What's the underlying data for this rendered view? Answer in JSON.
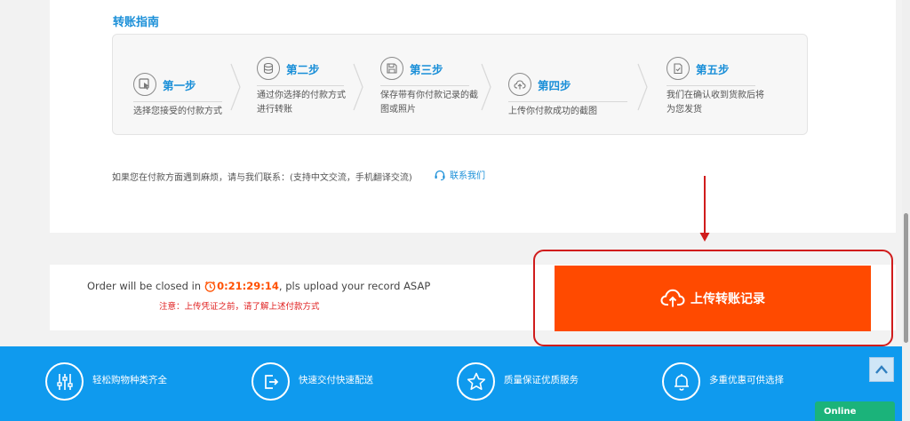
{
  "guide": {
    "title": "转账指南",
    "steps": [
      {
        "name": "第一步",
        "desc": [
          "选择您接受的付款方式"
        ],
        "icon": "cursor-icon"
      },
      {
        "name": "第二步",
        "desc": [
          "通过你选择的付款方式",
          "进行转账"
        ],
        "icon": "coins-icon"
      },
      {
        "name": "第三步",
        "desc": [
          "保存带有你付款记录的截",
          "图或照片"
        ],
        "icon": "save-icon"
      },
      {
        "name": "第四步",
        "desc": [
          "上传你付款成功的截图"
        ],
        "icon": "cloud-upload-icon"
      },
      {
        "name": "第五步",
        "desc": [
          "我们在确认收到货款后将",
          "为您发货"
        ],
        "icon": "clipboard-check-icon"
      }
    ],
    "contact_text": "如果您在付款方面遇到麻烦，请与我们联系：(支持中文交流，手机翻译交流)",
    "contact_link": "联系我们"
  },
  "order": {
    "prefix": "Order will be closed in",
    "countdown": "0:21:29:14",
    "suffix": ", pls upload your record ASAP",
    "note": "注意：上传凭证之前，请了解上述付款方式"
  },
  "upload_button": "上传转账记录",
  "footer": {
    "features": [
      {
        "label": "轻松购物种类齐全",
        "icon": "sliders-icon"
      },
      {
        "label": "快速交付快速配送",
        "icon": "delivery-exit-icon"
      },
      {
        "label": "质量保证优质服务",
        "icon": "star-icon"
      },
      {
        "label": "多重优惠可供选择",
        "icon": "bell-icon"
      }
    ]
  },
  "online_label": "Online",
  "colors": {
    "accent": "#1a8fd8",
    "button": "#ff4a00",
    "footer": "#0f9aee",
    "highlight": "#d01c1c",
    "online": "#1bb37a"
  }
}
